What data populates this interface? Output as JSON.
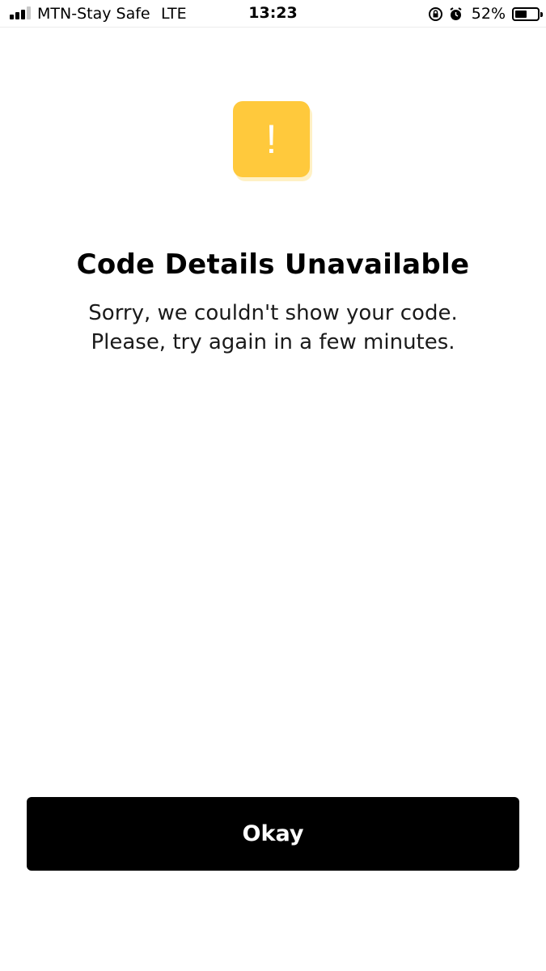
{
  "status_bar": {
    "carrier": "MTN-Stay Safe",
    "network": "LTE",
    "time": "13:23",
    "battery_percent_label": "52%",
    "battery_level": 0.52,
    "icons": [
      "signal-bars-icon",
      "rotation-lock-icon",
      "alarm-icon",
      "battery-icon"
    ]
  },
  "alert": {
    "icon": "exclamation-icon",
    "icon_glyph": "!",
    "title": "Code Details Unavailable",
    "message_line1": "Sorry, we couldn't show your code.",
    "message_line2": "Please, try again in a few minutes."
  },
  "actions": {
    "okay_label": "Okay"
  },
  "colors": {
    "badge": "#ffc93c",
    "button": "#000000",
    "button_text": "#ffffff",
    "background": "#ffffff"
  }
}
